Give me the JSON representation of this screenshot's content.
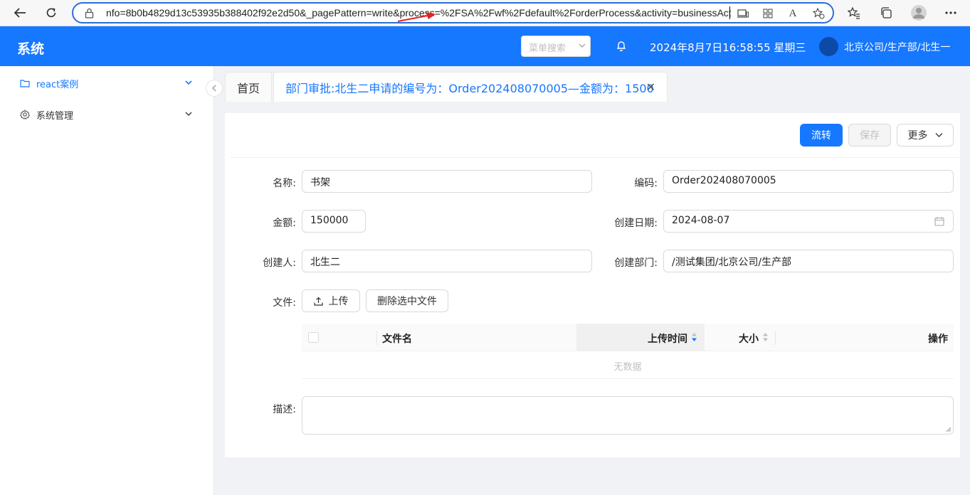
{
  "browser": {
    "url": "nfo=8b0b4829d13c53935b388402f92e2d50&_pagePattern=write&process=%2FSA%2Fwf%2Fdefault%2ForderProcess&activity=businessActiv",
    "back_icon": "arrow-left-icon",
    "refresh_icon": "refresh-icon"
  },
  "header": {
    "title": "系统",
    "menu_search_placeholder": "菜单搜索",
    "datetime": "2024年8月7日16:58:55 星期三",
    "org": "北京公司/生产部/北生一",
    "brand_color": "#1677ff"
  },
  "sidebar": {
    "items": [
      {
        "label": "react案例",
        "icon": "folder-icon"
      },
      {
        "label": "系统管理",
        "icon": "gear-icon"
      }
    ]
  },
  "tabs": [
    {
      "label": "首页"
    },
    {
      "label": "部门审批:北生二申请的编号为：Order202408070005—金额为：1500"
    }
  ],
  "toolbar": {
    "flow_label": "流转",
    "save_label": "保存",
    "more_label": "更多"
  },
  "form": {
    "name_label": "名称:",
    "name_value": "书架",
    "code_label": "编码:",
    "code_value": "Order202408070005",
    "amount_label": "金额:",
    "amount_value": "150000",
    "date_label": "创建日期:",
    "date_value": "2024-08-07",
    "creator_label": "创建人:",
    "creator_value": "北生二",
    "dept_label": "创建部门:",
    "dept_value": "/测试集团/北京公司/生产部",
    "file_label": "文件:",
    "upload_label": "上传",
    "delete_selected_label": "删除选中文件",
    "desc_label": "描述:",
    "desc_value": ""
  },
  "file_table": {
    "columns": [
      "文件名",
      "上传时间",
      "大小",
      "操作"
    ],
    "empty_text": "无数据"
  }
}
